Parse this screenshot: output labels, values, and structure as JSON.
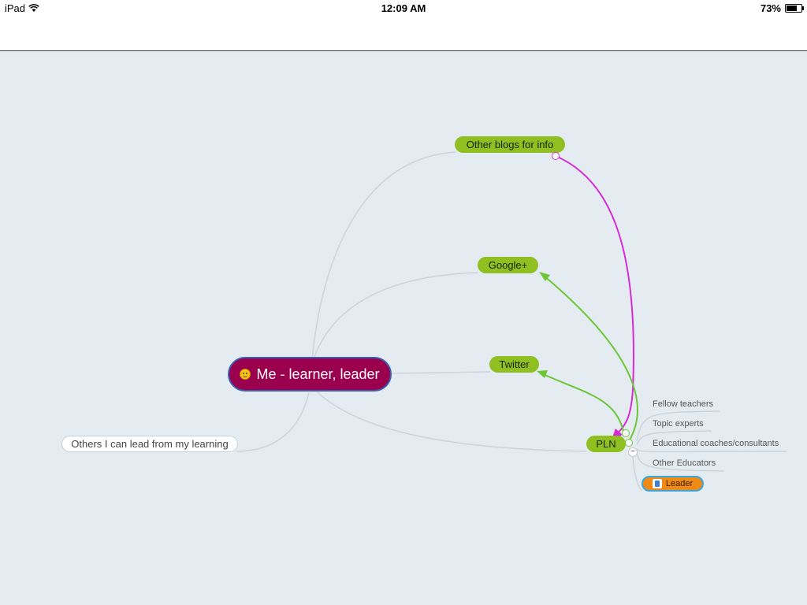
{
  "status_bar": {
    "device": "iPad",
    "time": "12:09 AM",
    "battery": "73%",
    "battery_level": 0.73
  },
  "mindmap": {
    "central": {
      "label": "Me - learner, leader",
      "icon": "smiley-icon"
    },
    "branches": {
      "other_blogs": "Other blogs for info",
      "google_plus": "Google+",
      "twitter": "Twitter",
      "pln": "PLN",
      "others_lead": "Others I can lead from my learning"
    },
    "pln_children": [
      "Fellow teachers",
      "Topic experts",
      "Educational coaches/consultants",
      "Other Educators"
    ],
    "leader": {
      "label": "Leader",
      "icon": "thumbs-up-icon"
    },
    "collapse_symbol": "−"
  },
  "colors": {
    "canvas": "#e5ecf1",
    "branch_green": "#8fbf21",
    "central_fill": "#9a004e",
    "central_border": "#3b5fb0",
    "link_magenta": "#d52bd6",
    "link_green": "#6cc636",
    "connector_gray": "#cdd4d9",
    "leader_fill": "#f08a17"
  }
}
